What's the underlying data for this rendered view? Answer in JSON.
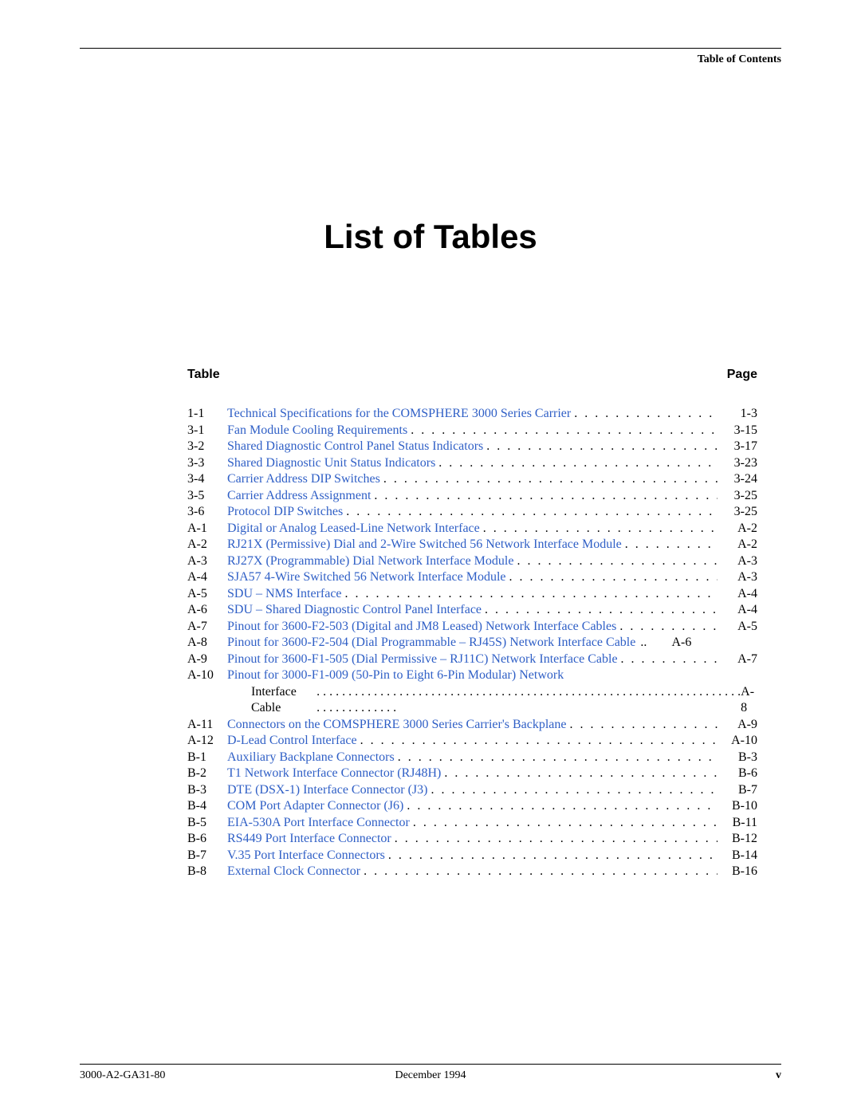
{
  "header_label": "Table of Contents",
  "title": "List of Tables",
  "col_table": "Table",
  "col_page": "Page",
  "entries": [
    {
      "num": "1-1",
      "text": "Technical Specifications for the COMSPHERE 3000 Series Carrier",
      "page": "1-3"
    },
    {
      "num": "3-1",
      "text": "Fan Module Cooling Requirements",
      "page": "3-15"
    },
    {
      "num": "3-2",
      "text": "Shared Diagnostic Control Panel Status Indicators",
      "page": "3-17"
    },
    {
      "num": "3-3",
      "text": "Shared Diagnostic Unit Status Indicators",
      "page": "3-23"
    },
    {
      "num": "3-4",
      "text": "Carrier Address DIP Switches",
      "page": "3-24"
    },
    {
      "num": "3-5",
      "text": "Carrier Address Assignment",
      "page": "3-25"
    },
    {
      "num": "3-6",
      "text": "Protocol DIP Switches",
      "page": "3-25"
    },
    {
      "num": "A-1",
      "text": "Digital or Analog Leased-Line Network Interface",
      "page": "A-2"
    },
    {
      "num": "A-2",
      "text": "RJ21X (Permissive) Dial and 2-Wire Switched 56 Network Interface Module",
      "page": "A-2"
    },
    {
      "num": "A-3",
      "text": "RJ27X (Programmable) Dial Network Interface Module",
      "page": "A-3"
    },
    {
      "num": "A-4",
      "text": "SJA57 4-Wire Switched 56 Network Interface Module",
      "page": "A-3"
    },
    {
      "num": "A-5",
      "text": "SDU – NMS Interface",
      "page": "A-4"
    },
    {
      "num": "A-6",
      "text": "SDU – Shared Diagnostic Control Panel Interface",
      "page": "A-4"
    },
    {
      "num": "A-7",
      "text": "Pinout for 3600-F2-503 (Digital and JM8 Leased) Network Interface Cables",
      "page": "A-5"
    },
    {
      "num": "A-8",
      "text": "Pinout for 3600-F2-504 (Dial Programmable – RJ45S) Network Interface Cable",
      "page": "A-6",
      "dots_override": ".."
    },
    {
      "num": "A-9",
      "text": "Pinout for 3600-F1-505 (Dial Permissive – RJ11C) Network Interface Cable",
      "page": "A-7"
    },
    {
      "num": "A-10",
      "text": "Pinout for 3000-F1-009 (50-Pin to Eight 6-Pin Modular) Network",
      "cont": "Interface Cable",
      "page": "A-8"
    },
    {
      "num": "A-11",
      "text": "Connectors on the COMSPHERE 3000 Series Carrier's Backplane",
      "page": "A-9"
    },
    {
      "num": "A-12",
      "text": "D-Lead Control Interface",
      "page": "A-10"
    },
    {
      "num": "B-1",
      "text": "Auxiliary Backplane Connectors",
      "page": "B-3"
    },
    {
      "num": "B-2",
      "text": "T1 Network Interface Connector (RJ48H)",
      "page": "B-6"
    },
    {
      "num": "B-3",
      "text": "DTE (DSX-1) Interface Connector (J3)",
      "page": "B-7"
    },
    {
      "num": "B-4",
      "text": "COM Port Adapter Connector (J6)",
      "page": "B-10"
    },
    {
      "num": "B-5",
      "text": "EIA-530A Port Interface Connector",
      "page": "B-11"
    },
    {
      "num": "B-6",
      "text": "RS449 Port Interface Connector",
      "page": "B-12"
    },
    {
      "num": "B-7",
      "text": "V.35 Port Interface  Connectors",
      "page": "B-14"
    },
    {
      "num": "B-8",
      "text": "External Clock  Connector",
      "page": "B-16"
    }
  ],
  "footer": {
    "left": "3000-A2-GA31-80",
    "center": "December 1994",
    "right": "v"
  }
}
